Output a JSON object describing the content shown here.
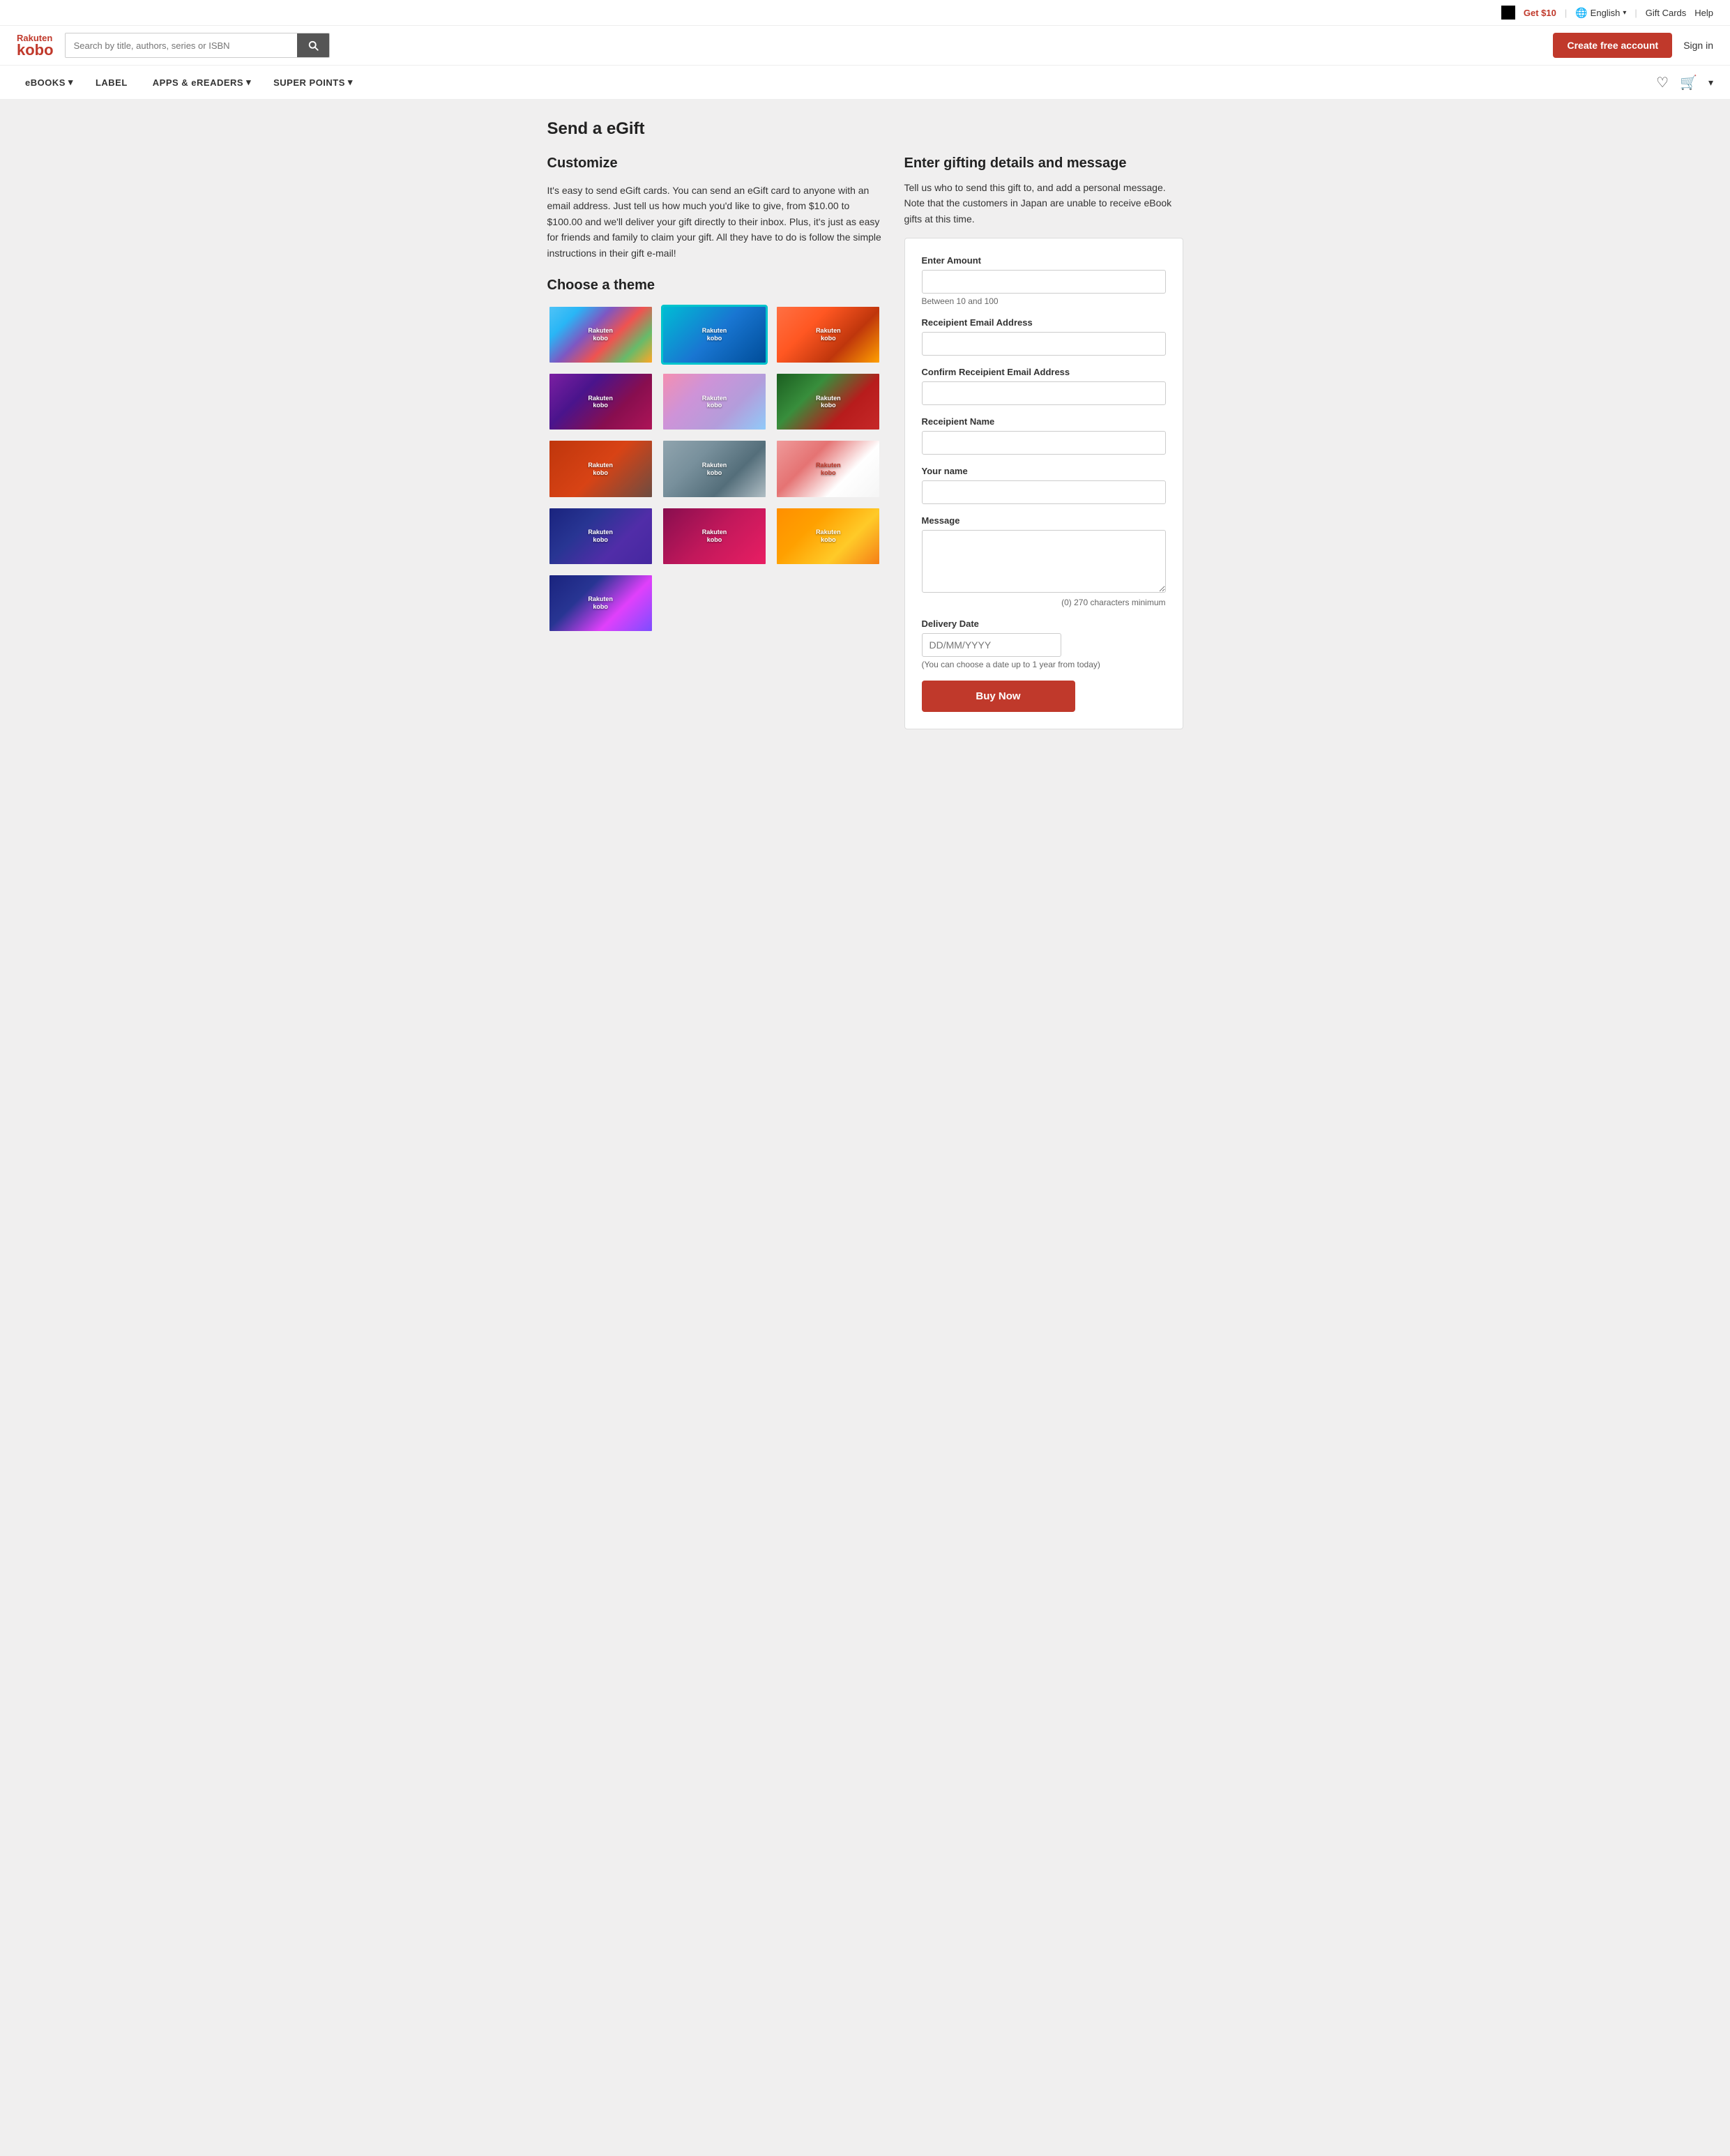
{
  "topbar": {
    "get10_label": "Get $10",
    "lang_label": "English",
    "giftcards_label": "Gift Cards",
    "help_label": "Help"
  },
  "header": {
    "logo_rakuten": "Rakuten",
    "logo_kobo": "kobo",
    "search_placeholder": "Search by title, authors, series or ISBN",
    "create_account_label": "Create free account",
    "sign_in_label": "Sign in"
  },
  "nav": {
    "items": [
      {
        "label": "eBOOKS",
        "has_dropdown": true
      },
      {
        "label": "LABEL",
        "has_dropdown": false
      },
      {
        "label": "APPS & eREADERS",
        "has_dropdown": true
      },
      {
        "label": "SUPER POINTS",
        "has_dropdown": true
      }
    ]
  },
  "page": {
    "title": "Send a eGift",
    "left": {
      "section_title": "Customize",
      "description": "It's easy to send eGift cards. You can send an eGift card to anyone with an email address. Just tell us how much you'd like to give, from $10.00 to $100.00 and we'll deliver your gift directly to their inbox. Plus, it's just as easy for friends and family to claim your gift. All they have to do is follow the simple instructions in their gift e-mail!",
      "theme_title": "Choose a theme",
      "themes": [
        {
          "id": 1,
          "style": "theme-rainbow",
          "selected": false
        },
        {
          "id": 2,
          "style": "theme-teal",
          "selected": true
        },
        {
          "id": 3,
          "style": "theme-orange",
          "selected": false
        },
        {
          "id": 4,
          "style": "theme-purple",
          "selected": false
        },
        {
          "id": 5,
          "style": "theme-birthday",
          "selected": false
        },
        {
          "id": 6,
          "style": "theme-christmas",
          "selected": false
        },
        {
          "id": 7,
          "style": "theme-gift",
          "selected": false
        },
        {
          "id": 8,
          "style": "theme-winter",
          "selected": false
        },
        {
          "id": 9,
          "style": "theme-snowman",
          "selected": false
        },
        {
          "id": 10,
          "style": "theme-hearts",
          "selected": false
        },
        {
          "id": 11,
          "style": "theme-love",
          "selected": false
        },
        {
          "id": 12,
          "style": "theme-flowers",
          "selected": false
        },
        {
          "id": 13,
          "style": "theme-celebration",
          "selected": false
        }
      ]
    },
    "right": {
      "form_title": "Enter gifting details and message",
      "form_intro": "Tell us who to send this gift to, and add a personal message. Note that the customers in Japan are unable to receive eBook gifts at this time.",
      "form": {
        "amount_label": "Enter Amount",
        "amount_hint": "Between 10 and 100",
        "recipient_email_label": "Receipient Email Address",
        "confirm_email_label": "Confirm Receipient Email Address",
        "recipient_name_label": "Receipient Name",
        "your_name_label": "Your name",
        "message_label": "Message",
        "message_hint": "(0) 270 characters minimum",
        "delivery_date_label": "Delivery Date",
        "delivery_date_placeholder": "DD/MM/YYYY",
        "delivery_date_hint": "(You can choose a date up to 1 year from today)",
        "buy_now_label": "Buy Now"
      }
    }
  }
}
